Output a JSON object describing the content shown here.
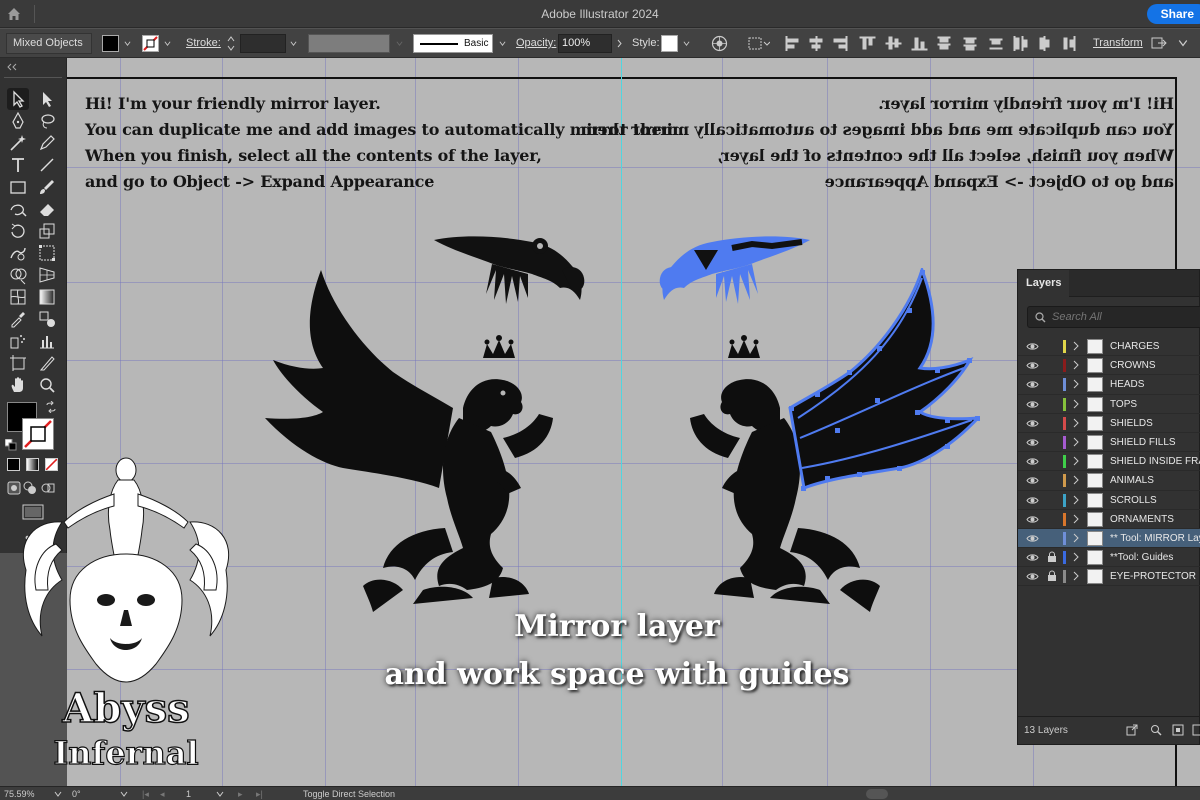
{
  "app": {
    "title": "Adobe Illustrator 2024",
    "share_label": "Share"
  },
  "controlbar": {
    "selection_label": "Mixed Objects",
    "stroke_label": "Stroke:",
    "brush_label": "Basic",
    "opacity_label": "Opacity:",
    "opacity_value": "100%",
    "style_label": "Style:",
    "transform_label": "Transform"
  },
  "canvas": {
    "instructions": [
      "Hi! I'm your friendly mirror layer.",
      "You can duplicate me and add images to automatically mirror them.",
      "When you finish, select all the contents of the layer,",
      "and go to Object -> Expand Appearance"
    ],
    "caption_line1": "Mirror layer",
    "caption_line2": "and work space with guides"
  },
  "layers_panel": {
    "tab_label": "Layers",
    "search_placeholder": "Search All",
    "count_label": "13 Layers",
    "layers": [
      {
        "name": "CHARGES",
        "color": "#e0d64a",
        "locked": false
      },
      {
        "name": "CROWNS",
        "color": "#8a1c1c",
        "locked": false
      },
      {
        "name": "HEADS",
        "color": "#6f8fd8",
        "locked": false
      },
      {
        "name": "TOPS",
        "color": "#86c23c",
        "locked": false
      },
      {
        "name": "SHIELDS",
        "color": "#d54b4b",
        "locked": false
      },
      {
        "name": "SHIELD FILLS",
        "color": "#a65bd1",
        "locked": false
      },
      {
        "name": "SHIELD INSIDE FRAME",
        "color": "#3fcf4a",
        "locked": false
      },
      {
        "name": "ANIMALS",
        "color": "#d09a4c",
        "locked": false
      },
      {
        "name": "SCROLLS",
        "color": "#3ca3c7",
        "locked": false
      },
      {
        "name": "ORNAMENTS",
        "color": "#d8762c",
        "locked": false
      },
      {
        "name": "** Tool: MIRROR Layer",
        "color": "#6f8fd8",
        "locked": false,
        "selected": true
      },
      {
        "name": "**Tool: Guides",
        "color": "#3a6ae0",
        "locked": true
      },
      {
        "name": "EYE-PROTECTOR",
        "color": "#8a8a8a",
        "locked": true
      }
    ]
  },
  "statusbar": {
    "zoom": "75.59%",
    "rotation": "0°",
    "artboard": "1",
    "tool_hint": "Toggle Direct Selection"
  },
  "logo": {
    "line1": "Abyss",
    "line2": "Infernal"
  },
  "colors": {
    "accent": "#1473e6",
    "selection_blue": "#4f7bf0",
    "guide_cyan": "#4fd6e0"
  }
}
